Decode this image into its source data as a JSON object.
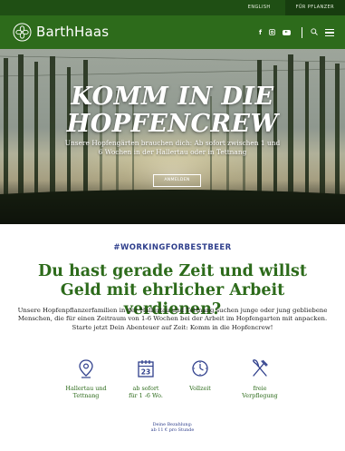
{
  "topbar": {
    "lang_label": "ENGLISH",
    "farmers_label": "FÜR PFLANZER"
  },
  "navbar": {
    "brand": "BarthHaas",
    "social": [
      "facebook-icon",
      "instagram-icon",
      "youtube-icon"
    ]
  },
  "hero": {
    "title_line1": "KOMM IN DIE",
    "title_line2": "HOPFENCREW",
    "subtitle": "Unsere Hopfengärten brauchen dich: Ab sofort zwischen 1 und 6 Wochen in der Hallertau oder in Tettnang",
    "button_label": "ANMELDEN"
  },
  "content": {
    "hashtag": "#WORKINGFORBESTBEER",
    "headline": "Du hast gerade Zeit und willst Geld mit ehrlicher Arbeit verdienen?",
    "intro": "Unsere Hopfenpflanzerfamilien in der Hallertau und Tettnang suchen junge oder jung gebliebene Menschen, die für einen Zeitraum von 1-6 Wochen bei der Arbeit im Hopfengarten mit anpacken.",
    "intro2": "Starte jetzt Dein Abenteuer auf Zeit: Komm in die Hopfencrew!"
  },
  "features": [
    {
      "icon": "location-pin-icon",
      "label_line1": "Hallertau und",
      "label_line2": "Tettnang"
    },
    {
      "icon": "calendar-icon",
      "icon_text": "23",
      "label_line1": "ab sofort",
      "label_line2": "für 1 -6 Wo."
    },
    {
      "icon": "clock-icon",
      "label_line1": "Vollzeit",
      "label_line2": ""
    },
    {
      "icon": "cutlery-icon",
      "label_line1": "freie",
      "label_line2": "Verpflegung"
    }
  ],
  "wage": {
    "line1": "Deine Bezahlung:",
    "line2": "ab 11 € pro Stunde"
  },
  "colors": {
    "brand_green": "#2d6b1b",
    "dark_green": "#1f4f14",
    "accent_blue": "#2f3f8c"
  }
}
